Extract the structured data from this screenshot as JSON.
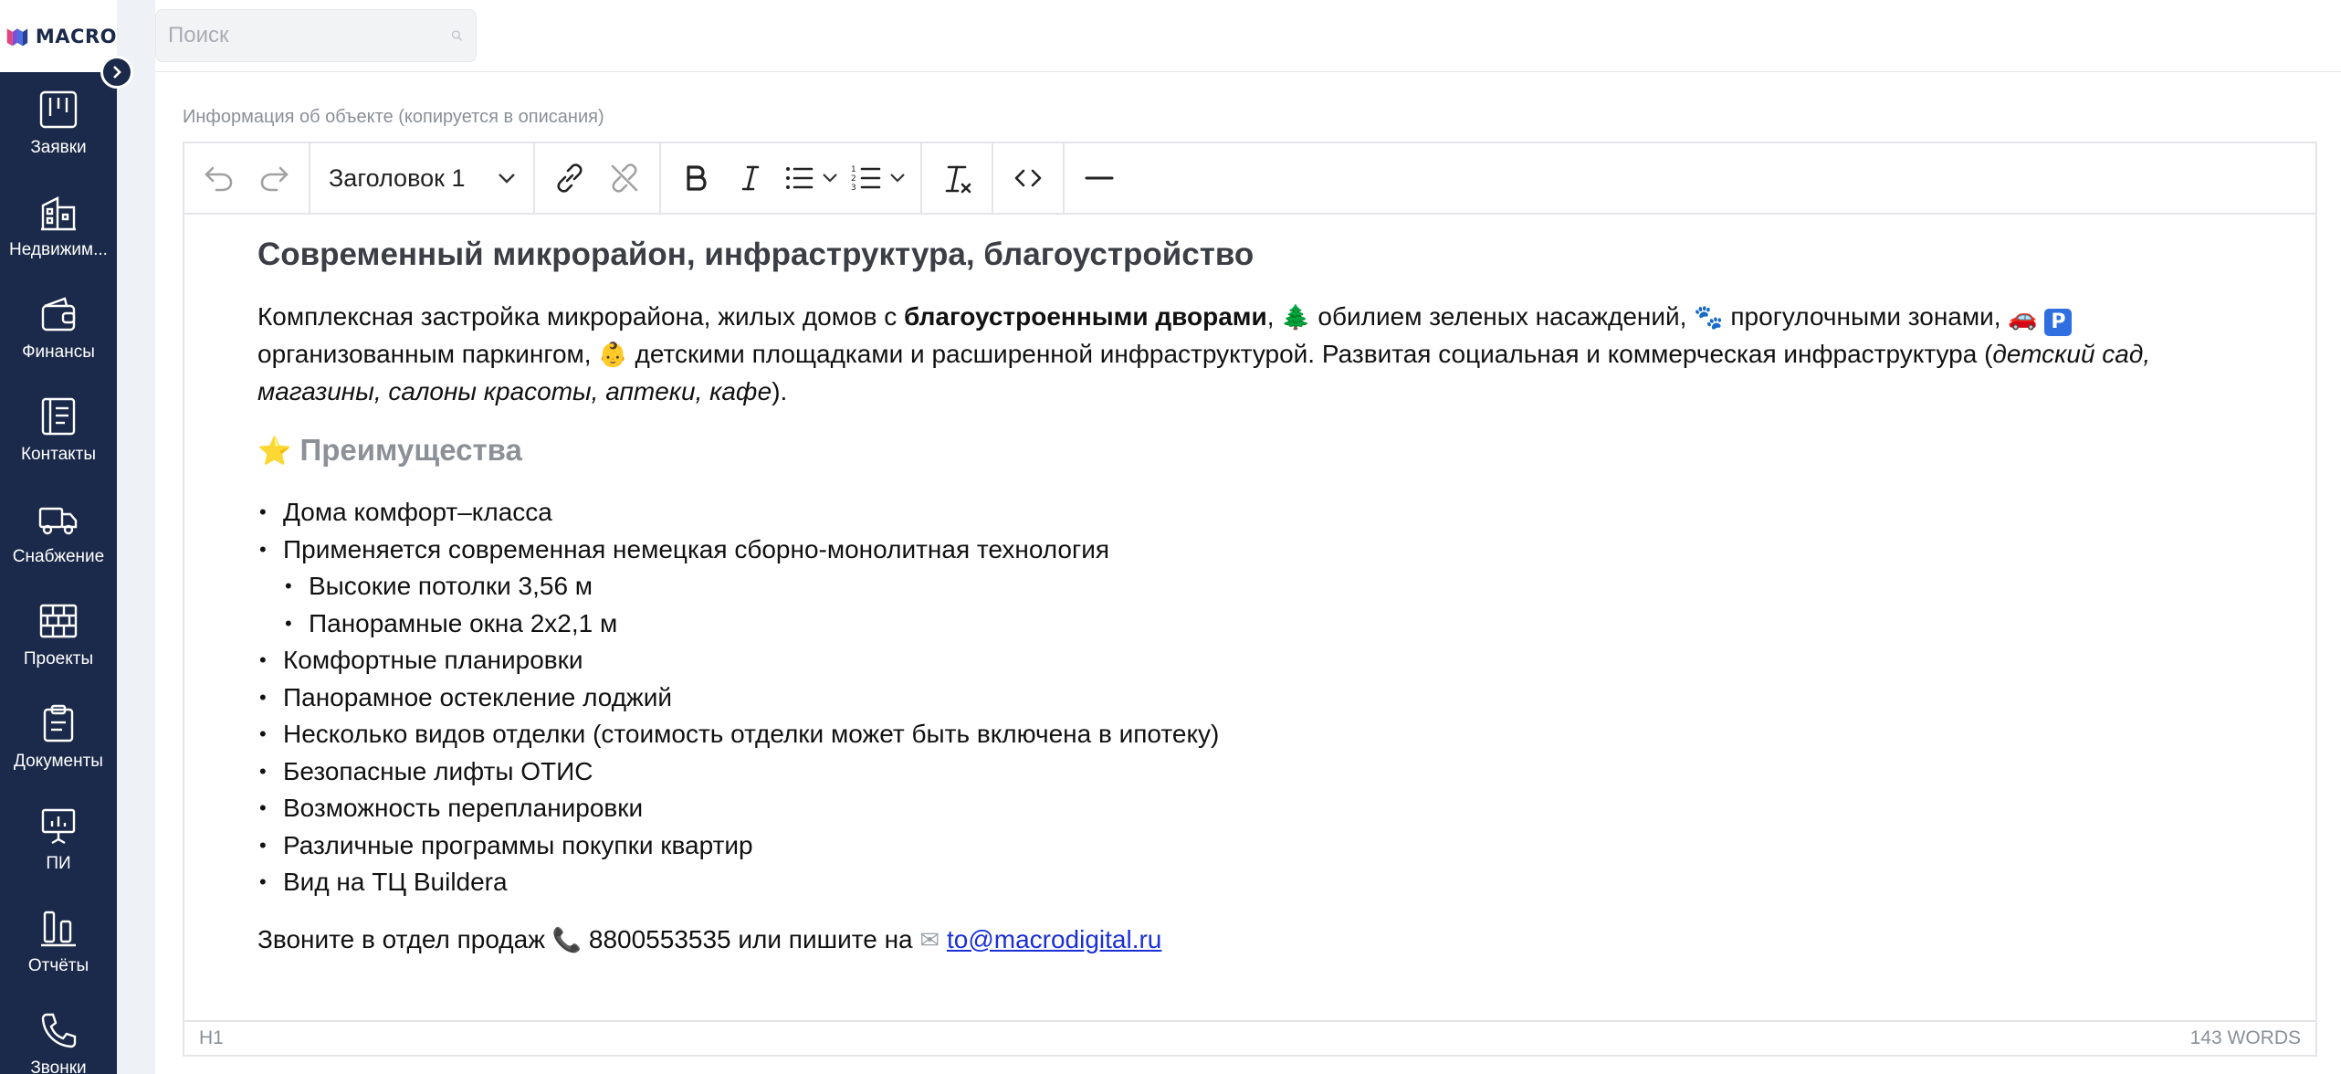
{
  "app": {
    "logo_text": "MACRO"
  },
  "colors": {
    "sidebar_bg": "#1b2a4a",
    "accent_link": "#1b2fd6",
    "parking_blue": "#2f6fe0"
  },
  "search": {
    "placeholder": "Поиск"
  },
  "sidebar": {
    "items": [
      {
        "label": "Заявки",
        "icon": "kanban-icon"
      },
      {
        "label": "Недвижим...",
        "icon": "building-icon"
      },
      {
        "label": "Финансы",
        "icon": "wallet-icon"
      },
      {
        "label": "Контакты",
        "icon": "contacts-book-icon"
      },
      {
        "label": "Снабжение",
        "icon": "truck-icon"
      },
      {
        "label": "Проекты",
        "icon": "brick-wall-icon"
      },
      {
        "label": "Документы",
        "icon": "clipboard-icon"
      },
      {
        "label": "ПИ",
        "icon": "presentation-icon"
      },
      {
        "label": "Отчёты",
        "icon": "bar-chart-icon"
      },
      {
        "label": "Звонки",
        "icon": "phone-icon"
      }
    ]
  },
  "field": {
    "label": "Информация об объекте (копируется в описания)"
  },
  "toolbar": {
    "format_value": "Заголовок 1"
  },
  "document": {
    "heading": "Современный микрорайон, инфраструктура, благоустройство",
    "intro": {
      "t1": "Комплексная застройка микрорайона, жилых домов с ",
      "bold1": "благоустроенными дворами",
      "t2": ", ",
      "e_tree": "🌲",
      "t3": " обилием зеленых насаждений, ",
      "e_paws": "🐾",
      "t4": " прогулочными зонами, ",
      "e_car": "🚗",
      "e_parking": "P",
      "t5": " организованным паркингом, ",
      "e_baby": "👶",
      "t6": " детскими площадками и расширенной инфраструктурой. Развитая социальная и коммерческая инфраструктура (",
      "italic1": "детский сад, магазины, салоны красоты, аптеки, кафе",
      "t7": ")."
    },
    "advantages_star": "⭐",
    "advantages_title": "Преимущества",
    "list_a": [
      "Дома комфорт–класса",
      "Применяется современная немецкая сборно-монолитная технология"
    ],
    "list_nested": [
      "Высокие потолки 3,56 м",
      "Панорамные окна 2х2,1 м"
    ],
    "list_b": [
      "Комфортные планировки",
      "Панорамное остекление лоджий",
      "Несколько видов отделки (стоимость отделки может быть включена в ипотеку)",
      "Безопасные лифты ОТИС",
      "Возможность перепланировки",
      "Различные программы покупки квартир",
      "Вид на ТЦ Buildera"
    ],
    "contact": {
      "t1": "Звоните в отдел продаж ",
      "e_phone": "📞",
      "phone": "8800553535",
      "t2": " или пишите на ",
      "e_mail": "✉",
      "email": "to@macrodigital.ru"
    }
  },
  "statusbar": {
    "element_path": "H1",
    "word_count": "143 WORDS"
  }
}
